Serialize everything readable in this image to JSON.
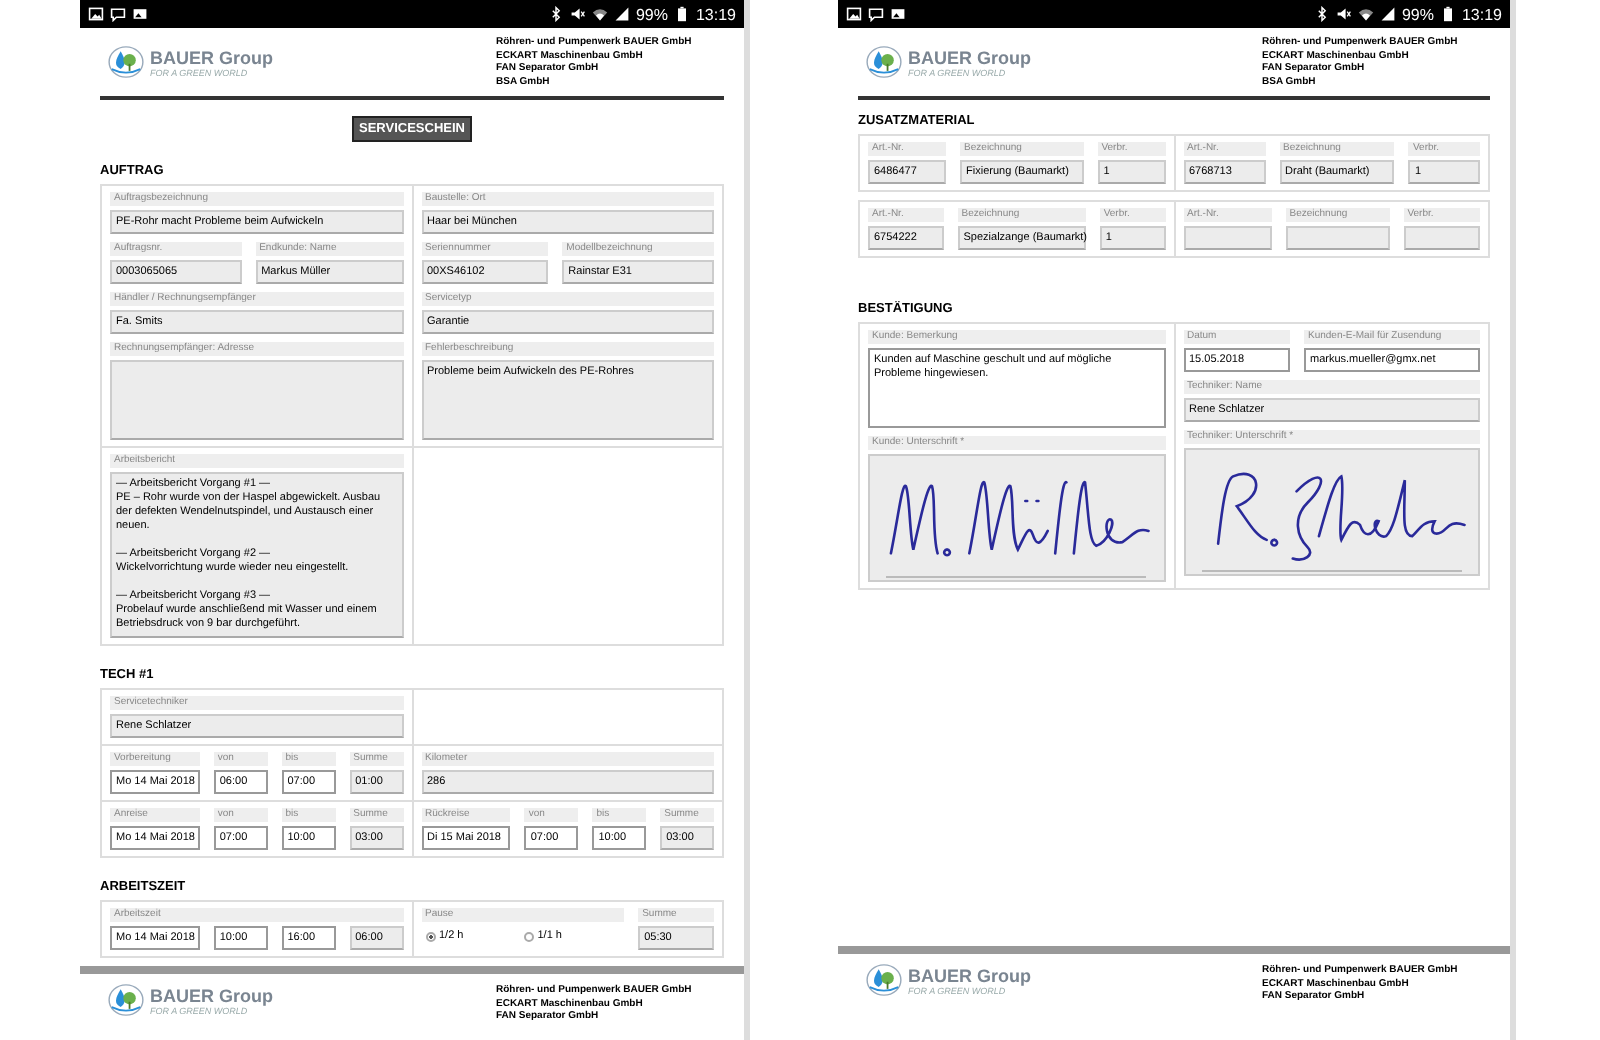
{
  "screens": [
    {
      "status_bar": {
        "battery": "99%",
        "time": "13:19"
      },
      "header": {
        "brand": "BAUER Group",
        "tagline": "FOR A GREEN WORLD",
        "companies": [
          "Röhren- und Pumpenwerk BAUER GmbH",
          "ECKART Maschinenbau GmbH",
          "FAN Separator GmbH",
          "BSA GmbH"
        ]
      },
      "title": "SERVICESCHEIN",
      "sections": [
        {
          "heading": "AUFTRAG",
          "boxes": [
            {
              "rows": [
                {
                  "columns": [
                    {
                      "lines": [
                        {
                          "fields": [
                            {
                              "label": "Auftragsbezeichnung",
                              "value": "PE-Rohr macht Probleme beim Aufwickeln",
                              "kind": "readonly"
                            }
                          ]
                        },
                        {
                          "fields": [
                            {
                              "label": "Auftragsnr.",
                              "value": "0003065065",
                              "kind": "readonly"
                            },
                            {
                              "label": "Endkunde: Name",
                              "value": "Markus Müller",
                              "kind": "readonly"
                            }
                          ]
                        },
                        {
                          "fields": [
                            {
                              "label": "Händler / Rechnungsempfänger",
                              "value": "Fa. Smits",
                              "kind": "readonly"
                            }
                          ]
                        },
                        {
                          "fields": [
                            {
                              "label": "Rechnungsempfänger: Adresse",
                              "kind": "area"
                            }
                          ]
                        }
                      ]
                    },
                    {
                      "lines": [
                        {
                          "fields": [
                            {
                              "label": "Baustelle: Ort",
                              "value": "Haar bei München",
                              "kind": "readonly"
                            }
                          ]
                        },
                        {
                          "fields": [
                            {
                              "label": "Seriennummer",
                              "value": "00XS46102",
                              "kind": "readonly"
                            },
                            {
                              "label": "Modellbezeichnung",
                              "value": "Rainstar E31",
                              "kind": "readonly"
                            }
                          ]
                        },
                        {
                          "fields": [
                            {
                              "label": "Servicetyp",
                              "value": "Garantie",
                              "kind": "readonly"
                            }
                          ]
                        },
                        {
                          "fields": [
                            {
                              "label": "Fehlerbeschreibung",
                              "value": "Probleme beim Aufwickeln des PE-Rohres",
                              "kind": "area"
                            }
                          ]
                        }
                      ]
                    }
                  ]
                },
                {
                  "columns": [
                    {
                      "lines": [
                        {
                          "fields": [
                            {
                              "label": "Arbeitsbericht",
                              "value": "— Arbeitsbericht Vorgang #1 —\nPE – Rohr wurde von der Haspel abgewickelt. Ausbau der defekten Wendelnutspindel, und Austausch einer neuen.\n\n— Arbeitsbericht Vorgang #2 —\nWickelvorrichtung wurde wieder neu eingestellt.\n\n— Arbeitsbericht Vorgang #3 —\nProbelauf wurde anschließend mit Wasser und einem Betriebsdruck von 9 bar durchgeführt.",
                              "kind": "area"
                            }
                          ]
                        }
                      ]
                    },
                    {}
                  ]
                }
              ]
            }
          ]
        },
        {
          "heading": "TECH #1",
          "boxes": [
            {
              "rows": [
                {
                  "columns": [
                    {
                      "lines": [
                        {
                          "fields": [
                            {
                              "label": "Servicetechniker",
                              "value": "Rene Schlatzer",
                              "kind": "readonly"
                            }
                          ]
                        }
                      ]
                    },
                    {}
                  ]
                },
                {
                  "columns": [
                    {
                      "lines": [
                        {
                          "fields": [
                            {
                              "label": "Vorbereitung",
                              "value": "Mo 14 Mai 2018",
                              "kind": "input"
                            },
                            {
                              "label": "von",
                              "value": "06:00",
                              "kind": "input"
                            },
                            {
                              "label": "bis",
                              "value": "07:00",
                              "kind": "input"
                            },
                            {
                              "label": "Summe",
                              "value": "01:00",
                              "kind": "readonly"
                            }
                          ]
                        }
                      ]
                    },
                    {
                      "lines": [
                        {
                          "fields": [
                            {
                              "label": "Kilometer",
                              "value": "286",
                              "kind": "readonly"
                            }
                          ]
                        }
                      ]
                    }
                  ]
                },
                {
                  "columns": [
                    {
                      "lines": [
                        {
                          "fields": [
                            {
                              "label": "Anreise",
                              "value": "Mo 14 Mai 2018",
                              "kind": "input"
                            },
                            {
                              "label": "von",
                              "value": "07:00",
                              "kind": "input"
                            },
                            {
                              "label": "bis",
                              "value": "10:00",
                              "kind": "input"
                            },
                            {
                              "label": "Summe",
                              "value": "03:00",
                              "kind": "readonly"
                            }
                          ]
                        }
                      ]
                    },
                    {
                      "lines": [
                        {
                          "fields": [
                            {
                              "label": "Rückreise",
                              "value": "Di 15 Mai 2018",
                              "kind": "input"
                            },
                            {
                              "label": "von",
                              "value": "07:00",
                              "kind": "input"
                            },
                            {
                              "label": "bis",
                              "value": "10:00",
                              "kind": "input"
                            },
                            {
                              "label": "Summe",
                              "value": "03:00",
                              "kind": "readonly"
                            }
                          ]
                        }
                      ]
                    }
                  ]
                }
              ]
            }
          ]
        },
        {
          "heading": "ARBEITSZEIT",
          "boxes": [
            {
              "rows": [
                {
                  "columns": [
                    {
                      "lines": [
                        {
                          "label": "Arbeitszeit",
                          "fields": [
                            {
                              "value": "Mo 14 Mai 2018",
                              "kind": "input"
                            },
                            {
                              "value": "10:00",
                              "kind": "input"
                            },
                            {
                              "value": "16:00",
                              "kind": "input"
                            },
                            {
                              "value": "06:00",
                              "kind": "readonly"
                            }
                          ]
                        }
                      ]
                    },
                    {
                      "lines": [
                        {
                          "fields": [
                            {
                              "label": "Pause",
                              "kind": "radio",
                              "options": [
                                {
                                  "label": "1/2 h",
                                  "selected": true
                                },
                                {
                                  "label": "1/1 h",
                                  "selected": false
                                }
                              ]
                            },
                            {
                              "label": "Summe",
                              "value": "05:30",
                              "kind": "readonly"
                            }
                          ]
                        }
                      ]
                    }
                  ]
                }
              ]
            }
          ]
        }
      ],
      "next_header": {
        "brand": "BAUER Group",
        "tagline": "FOR A GREEN WORLD",
        "companies": [
          "Röhren- und Pumpenwerk BAUER GmbH",
          "ECKART Maschinenbau GmbH",
          "FAN Separator GmbH"
        ]
      }
    },
    {
      "status_bar": {
        "battery": "99%",
        "time": "13:19"
      },
      "header": {
        "brand": "BAUER Group",
        "tagline": "FOR A GREEN WORLD",
        "companies": [
          "Röhren- und Pumpenwerk BAUER GmbH",
          "ECKART Maschinenbau GmbH",
          "FAN Separator GmbH",
          "BSA GmbH"
        ]
      },
      "sections": [
        {
          "heading": "ZUSATZMATERIAL",
          "boxes": [
            {
              "rows": [
                {
                  "columns": [
                    {
                      "lines": [
                        {
                          "fields": [
                            {
                              "label": "Art.-Nr.",
                              "value": "6486477",
                              "kind": "readonly"
                            },
                            {
                              "label": "Bezeichnung",
                              "value": "Fixierung (Baumarkt)",
                              "kind": "readonly"
                            },
                            {
                              "label": "Verbr.",
                              "value": "1",
                              "kind": "readonly"
                            }
                          ]
                        }
                      ]
                    },
                    {
                      "lines": [
                        {
                          "fields": [
                            {
                              "label": "Art.-Nr.",
                              "value": "6768713",
                              "kind": "readonly"
                            },
                            {
                              "label": "Bezeichnung",
                              "value": "Draht (Baumarkt)",
                              "kind": "readonly"
                            },
                            {
                              "label": "Verbr.",
                              "value": "1",
                              "kind": "readonly"
                            }
                          ]
                        }
                      ]
                    }
                  ]
                }
              ]
            },
            {
              "rows": [
                {
                  "columns": [
                    {
                      "lines": [
                        {
                          "fields": [
                            {
                              "label": "Art.-Nr.",
                              "value": "6754222",
                              "kind": "readonly"
                            },
                            {
                              "label": "Bezeichnung",
                              "value": "Spezialzange (Baumarkt)",
                              "kind": "readonly"
                            },
                            {
                              "label": "Verbr.",
                              "value": "1",
                              "kind": "readonly"
                            }
                          ]
                        }
                      ]
                    },
                    {
                      "lines": [
                        {
                          "fields": [
                            {
                              "label": "Art.-Nr.",
                              "kind": "readonly"
                            },
                            {
                              "label": "Bezeichnung",
                              "kind": "readonly"
                            },
                            {
                              "label": "Verbr.",
                              "kind": "readonly"
                            }
                          ]
                        }
                      ]
                    }
                  ]
                }
              ]
            }
          ]
        },
        {
          "heading": "BESTÄTIGUNG",
          "boxes": [
            {
              "rows": [
                {
                  "columns": [
                    {
                      "lines": [
                        {
                          "fields": [
                            {
                              "label": "Kunde: Bemerkung",
                              "value": "Kunden auf Maschine geschult und auf mögliche Probleme hingewiesen.",
                              "kind": "area-input"
                            }
                          ]
                        },
                        {
                          "fields": [
                            {
                              "label": "Kunde: Unterschrift *",
                              "kind": "signature"
                            }
                          ]
                        }
                      ]
                    },
                    {
                      "lines": [
                        {
                          "fields": [
                            {
                              "label": "Datum",
                              "value": "15.05.2018",
                              "kind": "input"
                            },
                            {
                              "label": "Kunden-E-Mail für Zusendung",
                              "value": "markus.mueller@gmx.net",
                              "kind": "input"
                            }
                          ]
                        },
                        {
                          "fields": [
                            {
                              "label": "Techniker: Name",
                              "value": "Rene Schlatzer",
                              "kind": "readonly"
                            }
                          ]
                        },
                        {
                          "fields": [
                            {
                              "label": "Techniker: Unterschrift *",
                              "kind": "signature"
                            }
                          ]
                        }
                      ]
                    }
                  ]
                }
              ]
            }
          ]
        }
      ],
      "next_header": {
        "brand": "BAUER Group",
        "tagline": "FOR A GREEN WORLD",
        "companies": [
          "Röhren- und Pumpenwerk BAUER GmbH",
          "ECKART Maschinenbau GmbH",
          "FAN Separator GmbH"
        ]
      }
    }
  ]
}
